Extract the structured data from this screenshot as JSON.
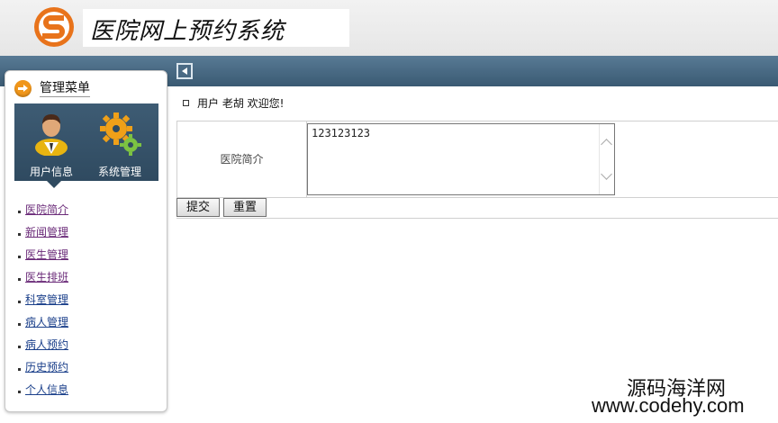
{
  "header": {
    "title": "医院网上预约系统",
    "logo_letter": "S"
  },
  "sidebar": {
    "menu_title": "管理菜单",
    "panel": [
      {
        "label": "用户信息",
        "icon": "user-icon"
      },
      {
        "label": "系统管理",
        "icon": "gears-icon"
      }
    ],
    "items": [
      {
        "label": "医院简介",
        "visited": true
      },
      {
        "label": "新闻管理",
        "visited": true
      },
      {
        "label": "医生管理",
        "visited": true
      },
      {
        "label": "医生排班",
        "visited": true
      },
      {
        "label": "科室管理",
        "visited": false
      },
      {
        "label": "病人管理",
        "visited": false
      },
      {
        "label": "病人预约",
        "visited": false
      },
      {
        "label": "历史预约",
        "visited": false
      },
      {
        "label": "个人信息",
        "visited": false
      }
    ]
  },
  "main": {
    "welcome": "用户 老胡 欢迎您!",
    "form": {
      "label": "医院简介",
      "value": "123123123"
    },
    "buttons": {
      "submit": "提交",
      "reset": "重置"
    }
  },
  "watermark": {
    "line1": "源码海洋网",
    "line2": "www.codehy.com"
  },
  "colors": {
    "navbar": "#3a5a73",
    "accent": "#f0961a",
    "link": "#1a3f8a",
    "visited_link": "#6a2a78"
  }
}
